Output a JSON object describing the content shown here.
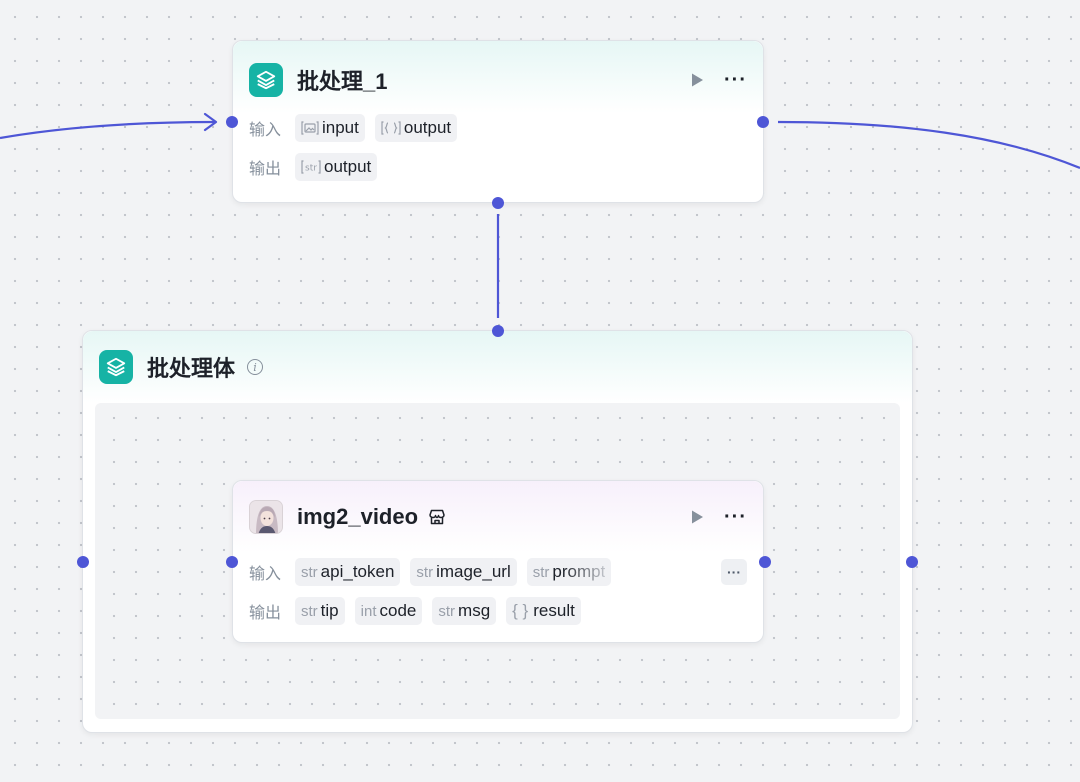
{
  "colors": {
    "accent": "#4e56d6",
    "teal": "#16b3a5",
    "canvas": "#f2f3f5"
  },
  "batch_node": {
    "title": "批处理_1",
    "icon": "layers-icon",
    "input_label": "输入",
    "output_label": "输出",
    "inputs": [
      {
        "type": "image-type-icon",
        "name": "input"
      },
      {
        "type": "array-type-icon",
        "name": "output"
      }
    ],
    "outputs": [
      {
        "type": "str",
        "name": "output"
      }
    ]
  },
  "batch_body": {
    "title": "批处理体",
    "icon": "layers-icon",
    "info_icon": "info-icon"
  },
  "plugin_node": {
    "title": "img2_video",
    "avatar": "portrait-avatar",
    "badge_icon": "store-icon",
    "input_label": "输入",
    "output_label": "输出",
    "more_label": "···",
    "inputs": [
      {
        "type": "str",
        "name": "api_token"
      },
      {
        "type": "str",
        "name": "image_url"
      },
      {
        "type": "str",
        "name": "prompt"
      }
    ],
    "outputs": [
      {
        "type": "str",
        "name": "tip"
      },
      {
        "type": "int",
        "name": "code"
      },
      {
        "type": "str",
        "name": "msg"
      },
      {
        "type": "{ }",
        "name": "result"
      }
    ]
  },
  "actions": {
    "run": "play-icon",
    "more": "···"
  }
}
